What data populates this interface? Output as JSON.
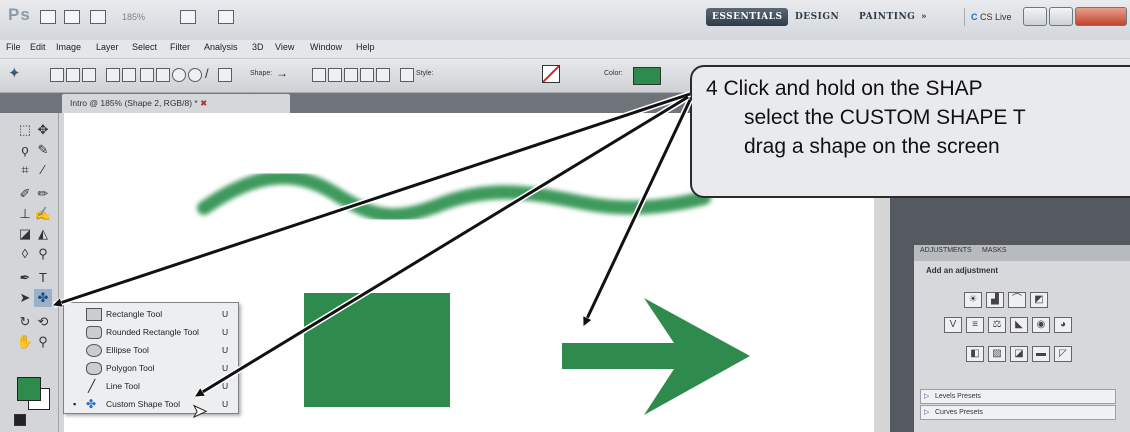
{
  "app": {
    "logo": "Ps",
    "zoom": "185%",
    "workspaces": [
      "ESSENTIALS",
      "DESIGN",
      "PAINTING",
      "»"
    ],
    "cs_live": "CS Live"
  },
  "menu": [
    "File",
    "Edit",
    "Image",
    "Layer",
    "Select",
    "Filter",
    "Analysis",
    "3D",
    "View",
    "Window",
    "Help"
  ],
  "options_bar": {
    "shape_label": "Shape:",
    "style_label": "Style:",
    "color_label": "Color:",
    "color": "#2e8b4d"
  },
  "document_tab": "Intro @ 185% (Shape 2, RGB/8) *",
  "flyout": {
    "items": [
      {
        "label": "Rectangle Tool",
        "shortcut": "U",
        "bullet": ""
      },
      {
        "label": "Rounded Rectangle Tool",
        "shortcut": "U",
        "bullet": ""
      },
      {
        "label": "Ellipse Tool",
        "shortcut": "U",
        "bullet": ""
      },
      {
        "label": "Polygon Tool",
        "shortcut": "U",
        "bullet": ""
      },
      {
        "label": "Line Tool",
        "shortcut": "U",
        "bullet": ""
      },
      {
        "label": "Custom Shape Tool",
        "shortcut": "U",
        "bullet": "▪"
      }
    ]
  },
  "colors": {
    "foreground": "#2e8b4d",
    "background": "#ffffff",
    "shape_green": "#2e8b4d"
  },
  "adjustments": {
    "tabs": [
      "ADJUSTMENTS",
      "MASKS"
    ],
    "title": "Add an adjustment",
    "presets": [
      "Levels Presets",
      "Curves Presets"
    ]
  },
  "callout": {
    "line1": "4 Click and hold on the SHAP",
    "line2": "select the CUSTOM SHAPE T",
    "line3": "drag a shape on the screen"
  }
}
